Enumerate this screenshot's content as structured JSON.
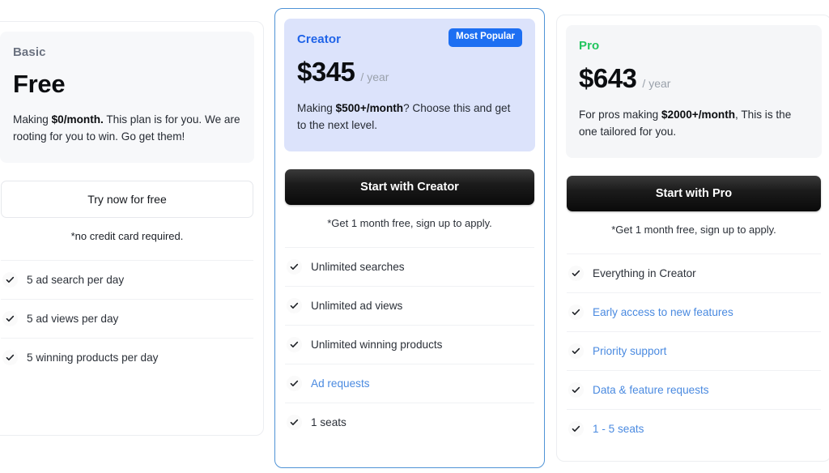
{
  "theme": {
    "accent_blue": "#1d6ff2",
    "link_blue": "#4a8ae0",
    "pro_green": "#22c55e",
    "creator_border": "#4f93d6",
    "creator_panel": "#dce3fb",
    "panel_gray": "#f7f8fa"
  },
  "icons": {
    "check": "check-icon"
  },
  "plans": [
    {
      "id": "basic",
      "name": "Basic",
      "price": "Free",
      "period": "",
      "badge": "",
      "blurb_parts": [
        {
          "text": "Making ",
          "bold": false
        },
        {
          "text": "$0/month.",
          "bold": true
        },
        {
          "text": " This plan is for you. We are rooting for you to win. Go get them!",
          "bold": false
        }
      ],
      "cta_label": "Try now for free",
      "cta_style": "outline",
      "cta_note": "*no credit card required.",
      "features": [
        {
          "label": "5 ad search per day",
          "link": false
        },
        {
          "label": "5 ad views per day",
          "link": false
        },
        {
          "label": "5 winning products per day",
          "link": false
        }
      ]
    },
    {
      "id": "creator",
      "name": "Creator",
      "price": "$345",
      "period": "/ year",
      "badge": "Most Popular",
      "blurb_parts": [
        {
          "text": "Making ",
          "bold": false
        },
        {
          "text": "$500+/month",
          "bold": true
        },
        {
          "text": "? Choose this and get to the next level.",
          "bold": false
        }
      ],
      "cta_label": "Start with Creator",
      "cta_style": "dark",
      "cta_note": "*Get 1 month free, sign up to apply.",
      "features": [
        {
          "label": "Unlimited searches",
          "link": false
        },
        {
          "label": "Unlimited ad views",
          "link": false
        },
        {
          "label": "Unlimited winning products",
          "link": false
        },
        {
          "label": "Ad requests",
          "link": true
        },
        {
          "label": "1 seats",
          "link": false
        }
      ]
    },
    {
      "id": "pro",
      "name": "Pro",
      "price": "$643",
      "period": "/ year",
      "badge": "",
      "blurb_parts": [
        {
          "text": "For pros making ",
          "bold": false
        },
        {
          "text": "$2000+/month",
          "bold": true
        },
        {
          "text": ", This is the one tailored for you.",
          "bold": false
        }
      ],
      "cta_label": "Start with Pro",
      "cta_style": "dark",
      "cta_note": "*Get 1 month free, sign up to apply.",
      "features": [
        {
          "label": "Everything in Creator",
          "link": false
        },
        {
          "label": "Early access to new features",
          "link": true
        },
        {
          "label": "Priority support",
          "link": true
        },
        {
          "label": "Data & feature requests",
          "link": true
        },
        {
          "label": "1 - 5 seats",
          "link": true
        }
      ]
    }
  ]
}
